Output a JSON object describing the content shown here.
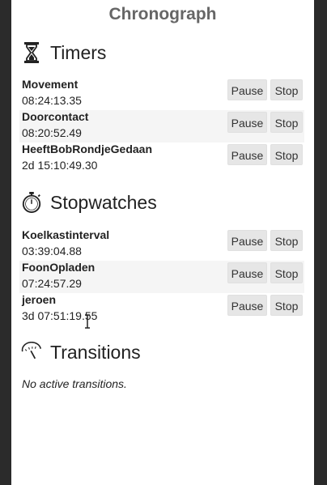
{
  "app": {
    "title": "Chronograph"
  },
  "timers": {
    "title": "Timers",
    "icon": "hourglass-icon",
    "items": [
      {
        "name": "Movement",
        "time": "08:24:13.35",
        "pause_label": "Pause",
        "stop_label": "Stop"
      },
      {
        "name": "Doorcontact",
        "time": "08:20:52.49",
        "pause_label": "Pause",
        "stop_label": "Stop"
      },
      {
        "name": "HeeftBobRondjeGedaan",
        "time": "2d 15:10:49.30",
        "pause_label": "Pause",
        "stop_label": "Stop"
      }
    ]
  },
  "stopwatches": {
    "title": "Stopwatches",
    "icon": "stopwatch-icon",
    "items": [
      {
        "name": "Koelkastinterval",
        "time": "03:39:04.88",
        "pause_label": "Pause",
        "stop_label": "Stop"
      },
      {
        "name": "FoonOpladen",
        "time": "07:24:57.29",
        "pause_label": "Pause",
        "stop_label": "Stop"
      },
      {
        "name": "jeroen",
        "time": "3d 07:51:19.55",
        "pause_label": "Pause",
        "stop_label": "Stop"
      }
    ]
  },
  "transitions": {
    "title": "Transitions",
    "icon": "gauge-icon",
    "empty_text": "No active transitions."
  }
}
